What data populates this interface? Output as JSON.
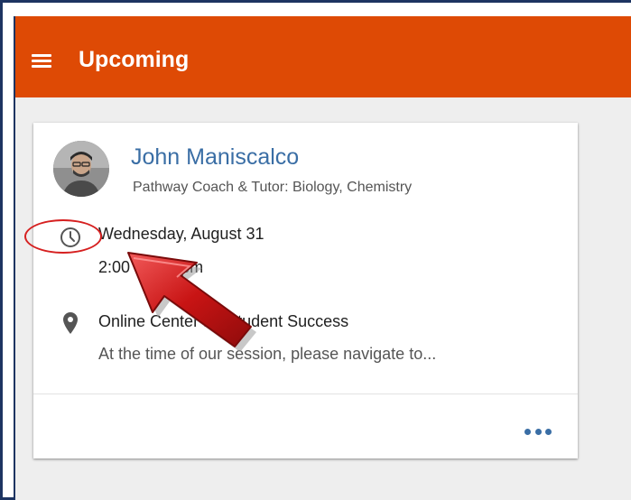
{
  "colors": {
    "appbar": "#de4a05",
    "accent": "#3a6ea5",
    "frame": "#1d3461",
    "annotation": "#d62020"
  },
  "appbar": {
    "title": "Upcoming",
    "menu_icon": "hamburger-menu-icon"
  },
  "appointment": {
    "coach_name": "John Maniscalco",
    "coach_role": "Pathway Coach & Tutor: Biology, Chemistry",
    "date": "Wednesday, August 31",
    "time": "2:00 - 3:00 pm",
    "clock_icon": "clock-icon",
    "location_icon": "map-pin-icon",
    "location_name": "Online Center for Student Success",
    "location_description": "At the time of our session, please navigate to...",
    "more_icon": "more-horizontal-icon"
  }
}
